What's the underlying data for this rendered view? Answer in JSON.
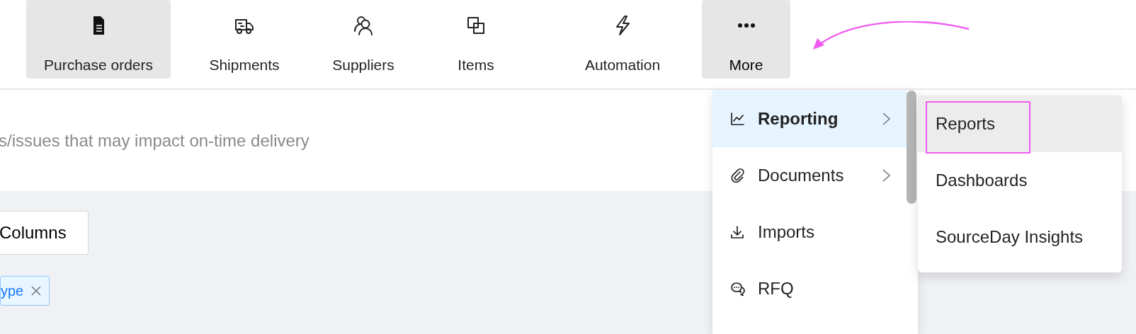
{
  "tabs": [
    {
      "label": "Purchase orders",
      "selected": true,
      "expanded": false
    },
    {
      "label": "Shipments",
      "selected": false,
      "expanded": false
    },
    {
      "label": "Suppliers",
      "selected": false,
      "expanded": false
    },
    {
      "label": "Items",
      "selected": false,
      "expanded": false
    },
    {
      "label": "Automation",
      "selected": false,
      "expanded": false
    },
    {
      "label": "More",
      "selected": true,
      "expanded": true
    }
  ],
  "banner": {
    "text": "s/issues that may impact on-time delivery"
  },
  "toolbar": {
    "columns_button": "Columns",
    "filter_tag": "ype"
  },
  "more_menu": {
    "items": [
      {
        "label": "Reporting",
        "selected": true,
        "submenu": true
      },
      {
        "label": "Documents",
        "selected": false,
        "submenu": true
      },
      {
        "label": "Imports",
        "selected": false,
        "submenu": false
      },
      {
        "label": "RFQ",
        "selected": false,
        "submenu": false
      }
    ],
    "submenu": [
      {
        "label": "Reports",
        "selected": true
      },
      {
        "label": "Dashboards",
        "selected": false
      },
      {
        "label": "SourceDay Insights",
        "selected": false
      }
    ]
  }
}
